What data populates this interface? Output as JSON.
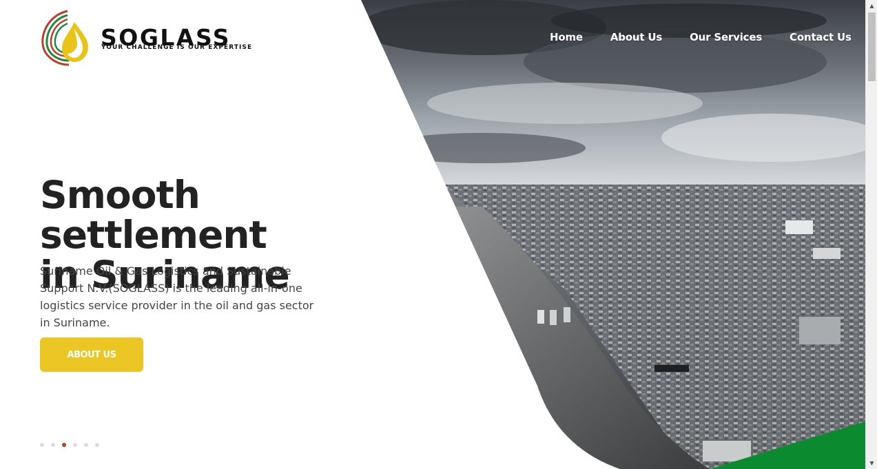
{
  "brand": {
    "name": "SOGLASS",
    "tagline": "YOUR CHALLENGE IS OUR EXPERTISE",
    "logo_colors": {
      "red": "#c0392b",
      "green": "#1e8a3c",
      "yellow": "#e8c419"
    }
  },
  "nav": {
    "items": [
      {
        "label": "Home"
      },
      {
        "label": "About Us"
      },
      {
        "label": "Our Services"
      },
      {
        "label": "Contact Us"
      }
    ]
  },
  "hero": {
    "headline_line1": "Smooth settlement",
    "headline_line2": "in Suriname",
    "lead": "Suriname Oil & Gas Logistics and Sustainable Support N.V.(SOGLASS) is the leading all-in-one logistics service provider in the oil and gas sector in Suriname.",
    "cta_label": "ABOUT US",
    "cta_color": "#ebc624",
    "image_icon": "aerial-city-river-photo",
    "accent_green": "#0b8a2f"
  },
  "slider": {
    "count": 6,
    "active_index": 2
  },
  "scrollbar": {
    "up_icon": "▲",
    "down_icon": "▼"
  }
}
